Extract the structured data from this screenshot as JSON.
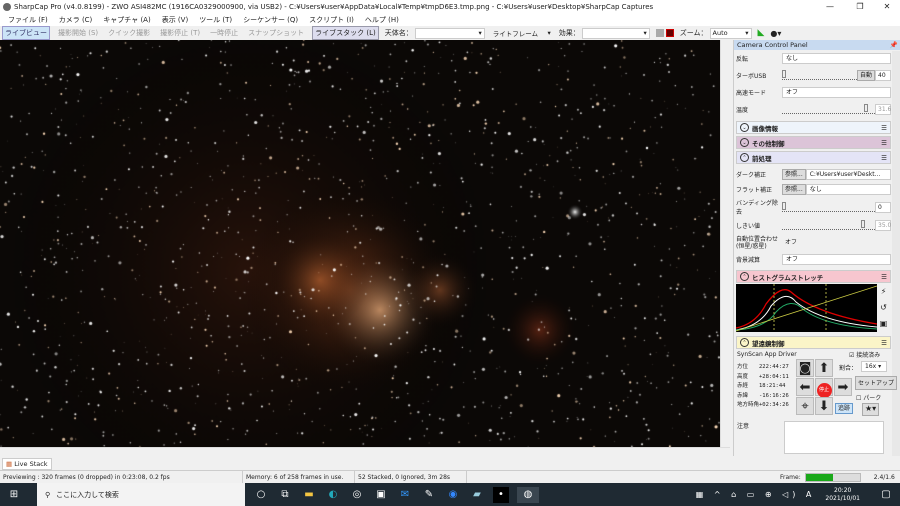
{
  "window": {
    "title": "SharpCap Pro (v4.0.8199) - ZWO ASI482MC (1916CA0329000900, via USB2) - C:¥Users¥user¥AppData¥Local¥Temp¥tmpD6E3.tmp.png - C:¥Users¥user¥Desktop¥SharpCap Captures",
    "minimize": "—",
    "maximize": "❐",
    "close": "✕"
  },
  "menu": [
    "ファイル (F)",
    "カメラ (C)",
    "キャプチャ (A)",
    "表示 (V)",
    "ツール (T)",
    "シーケンサー (Q)",
    "スクリプト (I)",
    "ヘルプ (H)"
  ],
  "toolbar": {
    "live_view": "ライブビュー",
    "start_capture": "撮影開始 (S)",
    "quick_capture": "クイック撮影",
    "stop_capture": "撮影停止 (T)",
    "pause": "一時停止",
    "snapshot": "スナップショット",
    "live_stack": "ライブスタック (L)",
    "object_label": "天体名：",
    "object_value": "",
    "frame_type": "ライトフレーム",
    "effect_label": "効果：",
    "effect_value": "",
    "zoom_label": "ズーム：",
    "zoom_value": "Auto"
  },
  "panel": {
    "title": "Camera Control Panel",
    "rows": {
      "flip_label": "反転",
      "flip_value": "なし",
      "turbo_label": "ターボUSB",
      "turbo_auto": "自動",
      "turbo_value": "40",
      "speed_label": "高速モード",
      "speed_value": "オフ",
      "temp_label": "温度",
      "temp_value": "31.6"
    },
    "sections": {
      "image_info": "画像情報",
      "other": "その他制御",
      "preprocess": "前処理",
      "histogram": "ヒストグラムストレッチ",
      "telescope": "望遠鏡制御"
    },
    "pre": {
      "dark_label": "ダーク補正",
      "browse": "参照...",
      "dark_value": "C:¥Users¥user¥Deskt…",
      "flat_label": "フラット補正",
      "flat_value": "なし",
      "banding_label": "バンディング除去",
      "banding_value": "0",
      "threshold_label": "しきい値",
      "threshold_value": "35.0",
      "align_label": "自動位置合わせ",
      "align_label2": "(恒星/惑星)",
      "align_value": "オフ",
      "bg_label": "背景減算",
      "bg_value": "オフ"
    },
    "scope": {
      "driver": "SynScan App Driver",
      "connected": "接続済み",
      "rate_label": "割合：",
      "rate_value": "16x",
      "stop": "停止",
      "setup": "セットアップ",
      "park": "パーク",
      "track": "追跡",
      "coords": [
        [
          "方位",
          "222:44:27"
        ],
        [
          "高度",
          "+28:04:11"
        ],
        [
          "赤経",
          "18:21:44"
        ],
        [
          "赤緯",
          "-16:16:26"
        ],
        [
          "地方時角",
          "+02:34:26"
        ]
      ],
      "notes_label": "注意"
    }
  },
  "tabs": {
    "live_stack": "Live Stack"
  },
  "status": {
    "preview": "Previewing : 320 frames (0 dropped) in 0:23:08, 0.2 fps",
    "memory": "Memory: 6 of 258 frames in use.",
    "stacked": "52 Stacked, 0 Ignored, 3m 28s",
    "frame_label": "Frame:",
    "frame_progress": 0.5,
    "ratio": "2.4/1.6"
  },
  "taskbar": {
    "search_placeholder": "ここに入力して検索",
    "time": "20:20",
    "date": "2021/10/01",
    "ime": "A"
  }
}
